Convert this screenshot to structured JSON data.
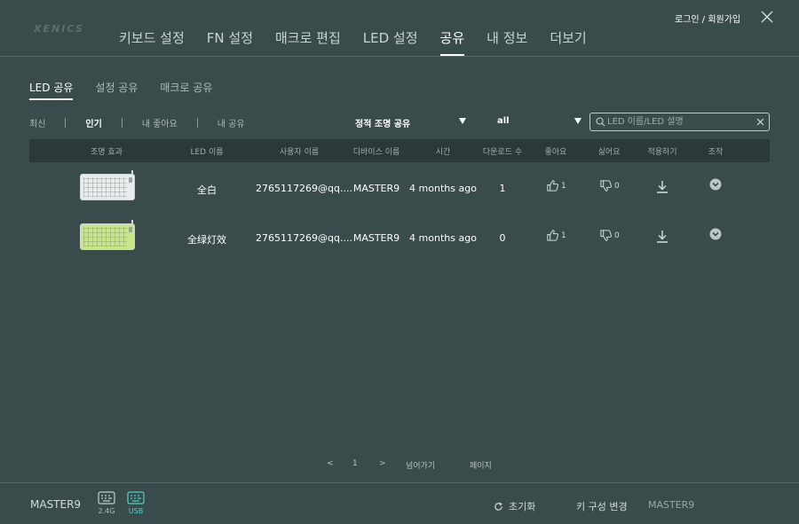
{
  "app": {
    "logo": "XENICS"
  },
  "nav": {
    "items": [
      {
        "label": "키보드 설정"
      },
      {
        "label": "FN 설정"
      },
      {
        "label": "매크로 편집"
      },
      {
        "label": "LED 설정"
      },
      {
        "label": "공유"
      },
      {
        "label": "내 정보"
      },
      {
        "label": "더보기"
      }
    ],
    "active_index": 4
  },
  "header": {
    "login_label": "로그인 / 회원가입"
  },
  "subtabs": [
    {
      "label": "LED 공유"
    },
    {
      "label": "설정 공유"
    },
    {
      "label": "매크로 공유"
    }
  ],
  "filters": [
    {
      "label": "최신"
    },
    {
      "label": "인기"
    },
    {
      "label": "내 좋아요"
    },
    {
      "label": "내 공유"
    }
  ],
  "dropdowns": {
    "type": "정적 조명 공유",
    "device": "all"
  },
  "search": {
    "placeholder": "LED 이름/LED 설명"
  },
  "table": {
    "headers": [
      "조명 효과",
      "LED 이름",
      "사용자 이름",
      "디바이스 이름",
      "시간",
      "다운로드 수",
      "좋아요",
      "싫어요",
      "적용하기",
      "조작"
    ],
    "rows": [
      {
        "preview": "white",
        "name": "全白",
        "user": "2765117269@qq....",
        "device": "MASTER9",
        "time": "4 months ago",
        "downloads": "1",
        "likes": "1",
        "dislikes": "0"
      },
      {
        "preview": "green",
        "name": "全绿灯效",
        "user": "2765117269@qq....",
        "device": "MASTER9",
        "time": "4 months ago",
        "downloads": "0",
        "likes": "1",
        "dislikes": "0"
      }
    ]
  },
  "pagination": {
    "prev": "<",
    "page": "1",
    "next": ">",
    "goto_label": "넘어가기",
    "page_label": "페이지"
  },
  "footer": {
    "device": "MASTER9",
    "conn_24g": "2.4G",
    "conn_usb": "USB",
    "reset_label": "초기화",
    "keyconfig_label": "키 구성 변경",
    "device_right": "MASTER9"
  },
  "colors": {
    "background": "#3a4b4c",
    "header_row": "#2b393a",
    "accent": "#48d7c7",
    "text": "#ffffff"
  }
}
